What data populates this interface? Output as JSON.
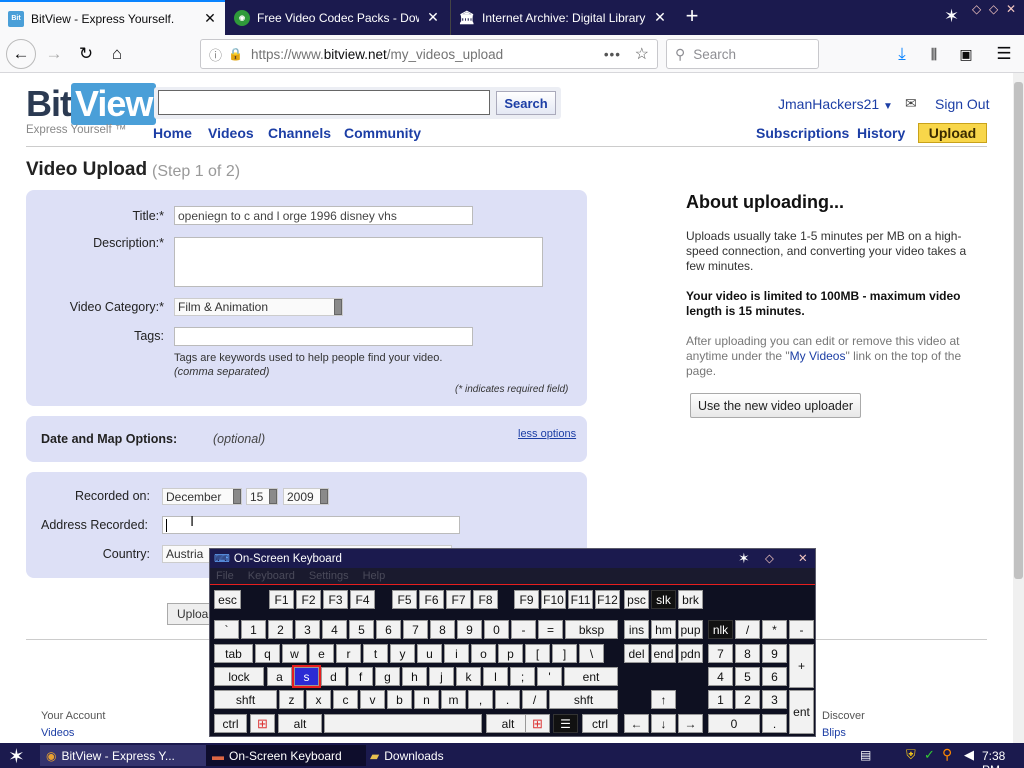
{
  "browser": {
    "tabs": [
      {
        "title": "BitView - Express Yourself.",
        "favicon": "BitView"
      },
      {
        "title": "Free Video Codec Packs - Downlo",
        "favicon": "globe"
      },
      {
        "title": "Internet Archive: Digital Library of",
        "favicon": "archive"
      }
    ],
    "url_prefix": "https://www.",
    "url_host": "bitview.net",
    "url_path": "/my_videos_upload",
    "search_placeholder": "Search"
  },
  "site": {
    "logo_bit": "Bit",
    "logo_view": "View",
    "tagline": "Express Yourself ™",
    "search_button": "Search",
    "nav": [
      "Home",
      "Videos",
      "Channels",
      "Community"
    ],
    "user": "JmanHackers21",
    "sign_out": "Sign Out",
    "subnav": [
      "Subscriptions",
      "History"
    ],
    "upload": "Upload"
  },
  "form": {
    "heading": "Video Upload",
    "step": "(Step 1 of 2)",
    "title_label": "Title:*",
    "title_value": "openiegn to c and l orge 1996 disney vhs",
    "description_label": "Description:*",
    "category_label": "Video Category:*",
    "category_value": "Film & Animation",
    "tags_label": "Tags:",
    "tags_help": "Tags are keywords used to help people find your video.",
    "tags_help2": "(comma separated)",
    "required_note": "(* indicates required field)",
    "date_map_label": "Date and Map Options:",
    "optional": "(optional)",
    "less_options": "less options",
    "recorded_on_label": "Recorded on:",
    "month": "December",
    "day": "15",
    "year": "2009",
    "address_label": "Address Recorded:",
    "country_label": "Country:",
    "country_value": "Austria",
    "upload_button": "Uploa"
  },
  "about": {
    "heading": "About uploading...",
    "p1": "Uploads usually take 1-5 minutes per MB on a high-speed connection, and converting your video takes a few minutes.",
    "p2": "Your video is limited to 100MB - maximum video length is 15 minutes.",
    "p3a": "After uploading you can edit or remove this video at anytime under the \"",
    "p3link": "My Videos",
    "p3b": "\" link on the top of the page.",
    "new_uploader_button": "Use the new video uploader"
  },
  "footer": {
    "your_account": "Your Account",
    "videos": "Videos",
    "discover": "Discover",
    "blips": "Blips"
  },
  "osk": {
    "title": "On-Screen Keyboard",
    "menu": [
      "File",
      "Keyboard",
      "Settings",
      "Help"
    ],
    "keys": {
      "esc": "esc",
      "f": [
        "F1",
        "F2",
        "F3",
        "F4",
        "F5",
        "F6",
        "F7",
        "F8",
        "F9",
        "F10",
        "F11",
        "F12"
      ],
      "psc": "psc",
      "slk": "slk",
      "brk": "brk",
      "row1": [
        "`",
        "1",
        "2",
        "3",
        "4",
        "5",
        "6",
        "7",
        "8",
        "9",
        "0",
        "-",
        "="
      ],
      "bksp": "bksp",
      "ins": "ins",
      "hm": "hm",
      "pup": "pup",
      "nlk": "nlk",
      "div": "/",
      "mul": "*",
      "sub": "-",
      "tab": "tab",
      "row2": [
        "q",
        "w",
        "e",
        "r",
        "t",
        "y",
        "u",
        "i",
        "o",
        "p",
        "[",
        "]",
        "\\"
      ],
      "del": "del",
      "end": "end",
      "pdn": "pdn",
      "n7": "7",
      "n8": "8",
      "n9": "9",
      "add": "+",
      "lock": "lock",
      "row3": [
        "a",
        "s",
        "d",
        "f",
        "g",
        "h",
        "j",
        "k",
        "l",
        ";",
        "'"
      ],
      "ent": "ent",
      "n4": "4",
      "n5": "5",
      "n6": "6",
      "shft": "shft",
      "row4": [
        "z",
        "x",
        "c",
        "v",
        "b",
        "n",
        "m",
        ",",
        ".",
        "/"
      ],
      "up": "↑",
      "n1": "1",
      "n2": "2",
      "n3": "3",
      "nent": "ent",
      "ctrl": "ctrl",
      "alt": "alt",
      "left": "←",
      "down": "↓",
      "right": "→",
      "n0": "0",
      "dot": "."
    }
  },
  "taskbar": {
    "items": [
      "BitView - Express Y...",
      "On-Screen Keyboard",
      "Downloads"
    ],
    "clock": "7:38 PM"
  }
}
